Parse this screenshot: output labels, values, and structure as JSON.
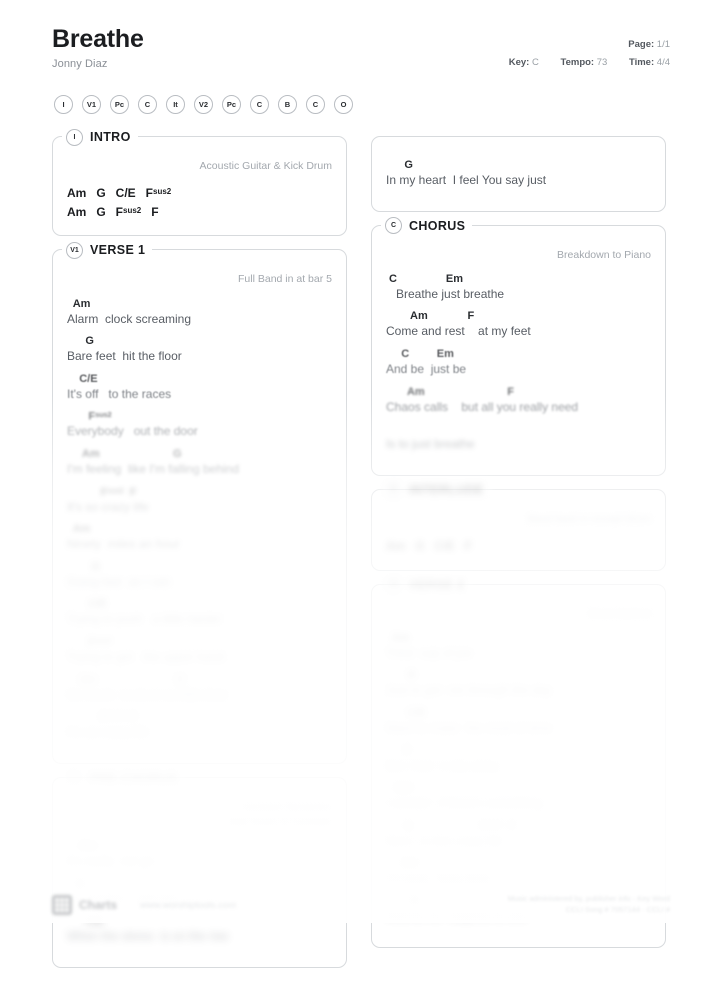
{
  "document": {
    "title": "Breathe",
    "artist": "Jonny Diaz"
  },
  "meta": {
    "page_label": "Page:",
    "page_value": "1/1",
    "key_label": "Key:",
    "key_value": "C",
    "tempo_label": "Tempo:",
    "tempo_value": "73",
    "time_label": "Time:",
    "time_value": "4/4"
  },
  "roadmap": [
    {
      "abbr": "I",
      "name": "intro"
    },
    {
      "abbr": "V1",
      "name": "verse-1"
    },
    {
      "abbr": "Pc",
      "name": "pre-chorus"
    },
    {
      "abbr": "C",
      "name": "chorus"
    },
    {
      "abbr": "It",
      "name": "interlude"
    },
    {
      "abbr": "V2",
      "name": "verse-2"
    },
    {
      "abbr": "Pc",
      "name": "pre-chorus"
    },
    {
      "abbr": "C",
      "name": "chorus"
    },
    {
      "abbr": "B",
      "name": "bridge"
    },
    {
      "abbr": "C",
      "name": "chorus"
    },
    {
      "abbr": "O",
      "name": "outro"
    }
  ],
  "intro": {
    "badge": "I",
    "title": "INTRO",
    "note": "Acoustic Guitar & Kick Drum",
    "rows": [
      "Am   G   C/E   F<sup>sus2</sup>",
      "Am   G   F<sup>sus2</sup>   F"
    ]
  },
  "verse1": {
    "badge": "V1",
    "title": "VERSE 1",
    "note": "Full Band in at bar 5",
    "lines": [
      {
        "chords": "  Am",
        "lyrics": "Alarm  clock screaming",
        "tier": ""
      },
      {
        "chords": "      G",
        "lyrics": "Bare feet  hit the floor",
        "tier": ""
      },
      {
        "chords": "    C/E",
        "lyrics": "It's off   to the races",
        "tier": "b1"
      },
      {
        "chords": "       F<sup>sus2</sup>",
        "lyrics": "Everybody   out the door",
        "tier": "b2"
      },
      {
        "chords": "     Am                        G",
        "lyrics": "I'm feeling  like I'm falling behind",
        "tier": "b3"
      },
      {
        "chords": "           F<sup>sus2</sup>  F",
        "lyrics": "It's so crazy life",
        "tier": "b4"
      },
      {
        "chords": "  Am",
        "lyrics": "Ninety  miles an hour",
        "tier": "b4"
      },
      {
        "chords": "        G",
        "lyrics": "Going fast  as I can",
        "tier": "b5"
      },
      {
        "chords": "       C/E",
        "lyrics": "Trying to push   a little harder",
        "tier": "b5"
      },
      {
        "chords": "       F<sup>sus2</sup>",
        "lyrics": "Trying to get   the upper hand",
        "tier": "b5"
      },
      {
        "chords": "    Am                          G",
        "lyrics": "So much  to do in so little time",
        "tier": "b6"
      },
      {
        "chords": "           F<sup>sus2</sup>  F",
        "lyrics": "It's so crazy life",
        "tier": "b6"
      }
    ]
  },
  "prechorus": {
    "badge": "Pc",
    "title": "PRE-CHORUS",
    "note_line1": "Increase Dynamics",
    "note_line2": "Add Snare & Cymbals",
    "lines": [
      {
        "chords": "    Am",
        "lyrics": "It's really  not go",
        "tier": "b5"
      },
      {
        "chords": "   G",
        "lyrics": "It's another   wild day",
        "tier": "b6"
      },
      {
        "chords": "      C/E",
        "lyrics": "When the stress  is on the rise",
        "tier": "b6"
      }
    ]
  },
  "chorus_tail": {
    "lines": [
      {
        "chords": "      G",
        "lyrics": "In my heart  I feel You say just",
        "tier": ""
      }
    ]
  },
  "chorus": {
    "badge": "C",
    "title": "CHORUS",
    "note": "Breakdown to Piano",
    "lines": [
      {
        "chords": " C                Em",
        "lyrics": "   Breathe just breathe",
        "tier": ""
      },
      {
        "chords": "        Am             F",
        "lyrics": "Come and rest    at my feet",
        "tier": ""
      },
      {
        "chords": "     C         Em",
        "lyrics": "And be  just be",
        "tier": "b1"
      },
      {
        "chords": "       Am                           F",
        "lyrics": "Chaos calls    but all you really need",
        "tier": "b2"
      },
      {
        "chords": " ",
        "lyrics": "Is to just breathe",
        "tier": "b4"
      }
    ]
  },
  "interlude": {
    "badge": "It",
    "title": "INTERLUDE",
    "note": "Band back in except Drum",
    "rows": [
      "Am   G   C/E   F"
    ]
  },
  "verse2": {
    "badge": "V2",
    "title": "VERSE 2",
    "note": "Drum back in",
    "lines": [
      {
        "chords": "  Am",
        "lyrics": "Third  cup of joe",
        "tier": "b5"
      },
      {
        "chords": "       G",
        "lyrics": "Just to get  me through the day",
        "tier": "b5"
      },
      {
        "chords": "       C/E",
        "lyrics": "Want to make  the most of time",
        "tier": "b5"
      },
      {
        "chords": "      F",
        "lyrics": "But I feel  it slip away",
        "tier": "b6"
      },
      {
        "chords": "   Am",
        "lyrics": "I wonder  if there's something",
        "tier": "b6"
      },
      {
        "chords": "      G                      F<sup>sus2</sup>  F",
        "lyrics": "More  to this crazy life",
        "tier": "b6"
      },
      {
        "chords": "     Am",
        "lyrics": "I'm busy  busy busy",
        "tier": "b6"
      },
      {
        "chords": "        G",
        "lyrics": "And it's no  surprise to see",
        "tier": "b6"
      }
    ]
  },
  "footer": {
    "brand_name": "Charts",
    "brand_url": "www.worshiptools.com",
    "copyright_line1": "Music administered by, publisher info - Key Word",
    "copyright_line2": "CCLI Song # 7057144   ·   CCLI #"
  }
}
